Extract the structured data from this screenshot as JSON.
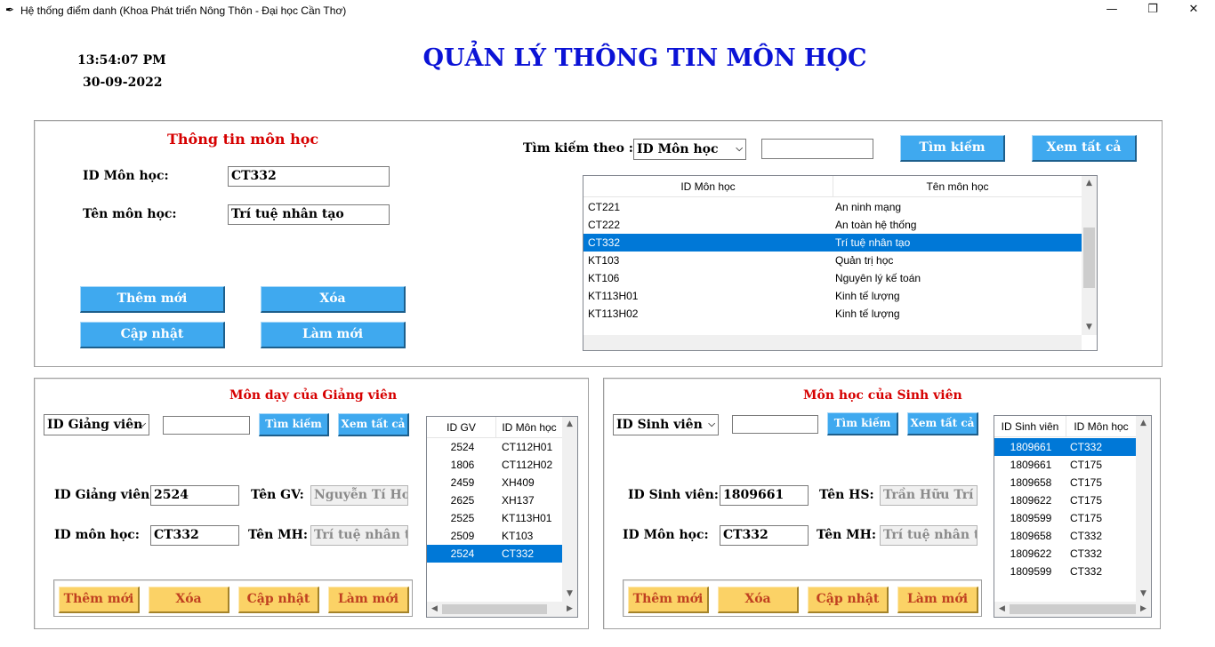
{
  "window": {
    "title": "Hệ thống điểm danh (Khoa Phát triển Nông Thôn - Đại học Cần Thơ)",
    "minimize": "—",
    "restore": "❐",
    "close": "✕"
  },
  "clock": {
    "time": "13:54:07 PM",
    "date": "30-09-2022"
  },
  "heading": "QUẢN LÝ THÔNG TIN MÔN HỌC",
  "course_panel": {
    "title": "Thông tin môn học",
    "id_label": "ID Môn học:",
    "id_value": "CT332",
    "name_label": "Tên môn học:",
    "name_value": "Trí tuệ nhân tạo",
    "btn_add": "Thêm mới",
    "btn_delete": "Xóa",
    "btn_update": "Cập nhật",
    "btn_refresh": "Làm mới",
    "search_label": "Tìm kiếm theo :",
    "search_by": "ID Môn học",
    "search_value": "",
    "btn_search": "Tìm kiếm",
    "btn_view_all": "Xem tất cả",
    "table": {
      "columns": [
        "ID Môn học",
        "Tên môn học"
      ],
      "rows": [
        [
          "CT221",
          "An ninh mạng"
        ],
        [
          "CT222",
          "An toàn hệ thống"
        ],
        [
          "CT332",
          "Trí tuệ nhân tạo"
        ],
        [
          "KT103",
          "Quản trị học"
        ],
        [
          "KT106",
          "Nguyên lý kế toán"
        ],
        [
          "KT113H01",
          "Kinh tế lượng"
        ],
        [
          "KT113H02",
          "Kinh tế lượng"
        ]
      ],
      "selected_row": 2
    }
  },
  "teacher_panel": {
    "title": "Môn dạy của Giảng viên",
    "search_by": "ID Giảng viên",
    "search_value": "",
    "btn_search": "Tìm kiếm",
    "btn_view_all": "Xem tất cả",
    "id_label": "ID Giảng viên:",
    "id_value": "2524",
    "name_label": "Tên GV:",
    "name_value": "Nguyễn Tí Hon",
    "course_label": "ID môn học:",
    "course_value": "CT332",
    "course_name_label": "Tên MH:",
    "course_name_value": "Trí tuệ nhân tạo",
    "btn_add": "Thêm mới",
    "btn_delete": "Xóa",
    "btn_update": "Cập nhật",
    "btn_refresh": "Làm mới",
    "table": {
      "columns": [
        "ID GV",
        "ID Môn học"
      ],
      "rows": [
        [
          "2524",
          "CT112H01"
        ],
        [
          "1806",
          "CT112H02"
        ],
        [
          "2459",
          "XH409"
        ],
        [
          "2625",
          "XH137"
        ],
        [
          "2525",
          "KT113H01"
        ],
        [
          "2509",
          "KT103"
        ],
        [
          "2524",
          "CT332"
        ]
      ],
      "selected_row": 6
    }
  },
  "student_panel": {
    "title": "Môn học của Sinh viên",
    "search_by": "ID Sinh viên",
    "search_value": "",
    "btn_search": "Tìm kiếm",
    "btn_view_all": "Xem tất cả",
    "id_label": "ID Sinh viên:",
    "id_value": "1809661",
    "name_label": "Tên HS:",
    "name_value": "Trần Hữu Trí",
    "course_label": "ID Môn học:",
    "course_value": "CT332",
    "course_name_label": "Tên MH:",
    "course_name_value": "Trí tuệ nhân tạo",
    "btn_add": "Thêm mới",
    "btn_delete": "Xóa",
    "btn_update": "Cập nhật",
    "btn_refresh": "Làm mới",
    "table": {
      "columns": [
        "ID Sinh viên",
        "ID Môn học"
      ],
      "rows": [
        [
          "1809661",
          "CT332"
        ],
        [
          "1809661",
          "CT175"
        ],
        [
          "1809658",
          "CT175"
        ],
        [
          "1809622",
          "CT175"
        ],
        [
          "1809599",
          "CT175"
        ],
        [
          "1809658",
          "CT332"
        ],
        [
          "1809622",
          "CT332"
        ],
        [
          "1809599",
          "CT332"
        ]
      ],
      "selected_row": 0
    }
  },
  "colors": {
    "heading": "#0b13d6",
    "section_title": "#d60000",
    "blue_button": "#3fa9ef",
    "yellow_button": "#fbd266",
    "yellow_button_text": "#c04020",
    "selection": "#0078d7"
  },
  "icons": {
    "app": "feather-icon",
    "dropdown": "chevron-down-icon",
    "scroll_up": "chevron-up-icon",
    "scroll_down": "chevron-down-icon",
    "scroll_left": "chevron-left-icon",
    "scroll_right": "chevron-right-icon"
  }
}
